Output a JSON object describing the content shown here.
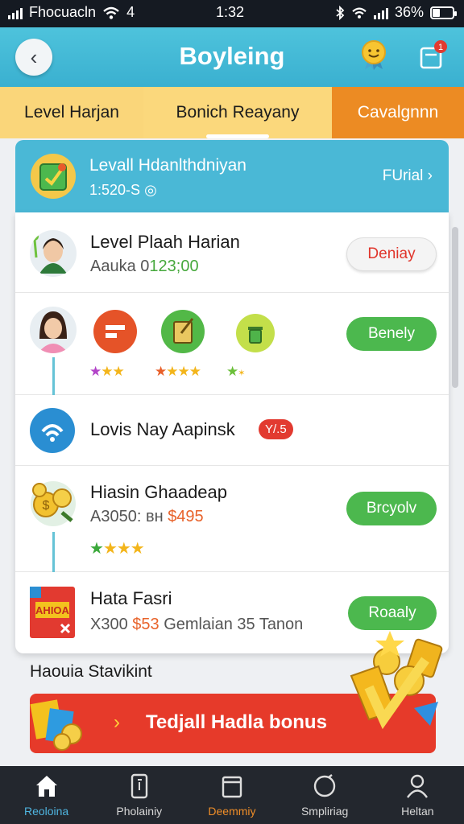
{
  "status": {
    "carrier": "Fhocuacln",
    "network": "4",
    "time": "1:32",
    "battery": "36%"
  },
  "header": {
    "title": "Boyleing"
  },
  "tabs": [
    {
      "label": "Level Harjan"
    },
    {
      "label": "Bonich Reayany"
    },
    {
      "label": "Cavalgnnn"
    }
  ],
  "banner": {
    "title": "Levall Hdanlthdniyan",
    "subtitle": "1:520-S",
    "link": "FUrial"
  },
  "rows": [
    {
      "name": "Level Plaah Harian",
      "sub_prefix": "Aauka 0",
      "sub_value": "123;00",
      "button": "Deniay"
    },
    {
      "button": "Benely"
    },
    {
      "name": "Lovis Nay Aapinsk",
      "badge": "Y/.5"
    },
    {
      "name": "Hiasin Ghaadeap",
      "sub_prefix": "A3050: вн",
      "sub_value": "$495",
      "button": "Brcyolv"
    },
    {
      "name": "Hata Fasri",
      "sub_prefix": "X300",
      "sub_value": "$53",
      "sub_suffix": "Gemlaian 35 Tanon",
      "button": "Roaaly"
    }
  ],
  "promo": {
    "section_title": "Haouia Stavikint",
    "label": "Tedjall Hadla bonus"
  },
  "nav": [
    {
      "label": "Reoloina",
      "icon": "home-icon"
    },
    {
      "label": "Pholainiy",
      "icon": "phone-icon"
    },
    {
      "label": "Deemmiy",
      "icon": "square-icon"
    },
    {
      "label": "Smpliriag",
      "icon": "circle-icon"
    },
    {
      "label": "Heltan",
      "icon": "person-icon"
    }
  ],
  "colors": {
    "header": "#3ab0d0",
    "accent_orange": "#ec8b23",
    "green": "#4cb84e",
    "red": "#e23a30"
  }
}
